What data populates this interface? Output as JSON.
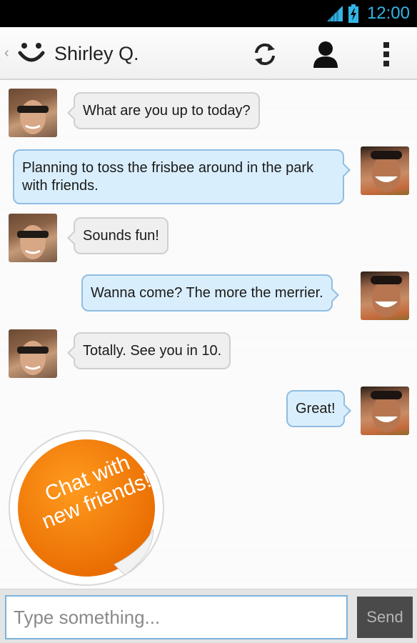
{
  "status_bar": {
    "time": "12:00",
    "signal_icon": "signal-icon",
    "battery_icon": "battery-charging-icon",
    "accent_color": "#33b5e5"
  },
  "action_bar": {
    "back_glyph": "‹",
    "app_icon": "smiley-icon",
    "contact_name": "Shirley Q.",
    "actions": [
      {
        "name": "refresh",
        "icon": "refresh-icon"
      },
      {
        "name": "profile",
        "icon": "person-icon"
      },
      {
        "name": "overflow",
        "icon": "overflow-menu-icon"
      }
    ]
  },
  "messages": [
    {
      "sender": "Shirley Q.",
      "direction": "incoming",
      "text": "What are you up to today?"
    },
    {
      "sender": "me",
      "direction": "outgoing",
      "text": "Planning to toss the frisbee around in the park with friends."
    },
    {
      "sender": "Shirley Q.",
      "direction": "incoming",
      "text": "Sounds fun!"
    },
    {
      "sender": "me",
      "direction": "outgoing",
      "text": "Wanna come? The more the merrier."
    },
    {
      "sender": "Shirley Q.",
      "direction": "incoming",
      "text": "Totally. See you in 10."
    },
    {
      "sender": "me",
      "direction": "outgoing",
      "text": "Great!"
    }
  ],
  "sticker": {
    "text": "Chat with new friends!",
    "color": "#f07800"
  },
  "composer": {
    "placeholder": "Type something...",
    "value": "",
    "send_label": "Send"
  },
  "colors": {
    "incoming_bubble": "#efefef",
    "outgoing_bubble": "#d9eefc",
    "outgoing_border": "#8fbde2"
  }
}
